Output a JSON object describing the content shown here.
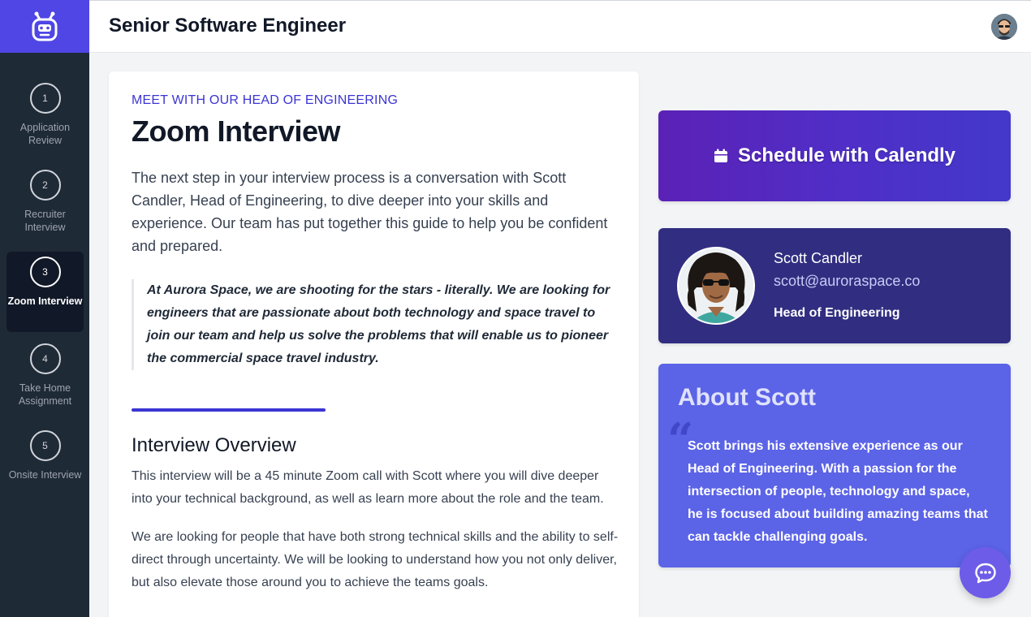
{
  "header": {
    "title": "Senior Software Engineer"
  },
  "sidebar": {
    "steps": [
      {
        "number": "1",
        "label": "Application Review",
        "active": false
      },
      {
        "number": "2",
        "label": "Recruiter Interview",
        "active": false
      },
      {
        "number": "3",
        "label": "Zoom Interview",
        "active": true
      },
      {
        "number": "4",
        "label": "Take Home Assignment",
        "active": false
      },
      {
        "number": "5",
        "label": "Onsite Interview",
        "active": false
      }
    ]
  },
  "main": {
    "eyebrow": "MEET WITH OUR HEAD OF ENGINEERING",
    "title": "Zoom Interview",
    "intro": "The next step in your interview process is a conversation with Scott Candler, Head of Engineering, to dive deeper into your skills and experience. Our team has put together this guide to help you be confident and prepared.",
    "quote": "At Aurora Space, we are shooting for the stars - literally. We are looking for engineers that are passionate about both technology and space travel to join our team and help us solve the problems that will enable us to pioneer the commercial space travel industry.",
    "overview_title": "Interview Overview",
    "overview_p1": "This interview will be a 45 minute Zoom call with Scott where you will dive deeper into your technical background, as well as learn more about the role and the team.",
    "overview_p2": "We are looking for people that have both strong technical skills and the ability to self-direct through uncertainty. We will be looking to understand how you not only deliver, but also elevate those around you to achieve the teams goals."
  },
  "schedule": {
    "label": "Schedule with Calendly",
    "icon": "calendar-icon"
  },
  "profile": {
    "name": "Scott Candler",
    "email": "scott@auroraspace.co",
    "role": "Head of Engineering"
  },
  "about": {
    "title": "About Scott",
    "quote_mark": "“",
    "text": "Scott brings his extensive experience as our Head of Engineering. With a passion for the intersection of people, technology and space, he is focused about building amazing teams that can tackle challenging goals."
  },
  "colors": {
    "accent": "#4f46e5",
    "sidebar_bg": "#1f2a37",
    "profile_bg": "#312e81",
    "about_bg": "#5b63e7"
  }
}
